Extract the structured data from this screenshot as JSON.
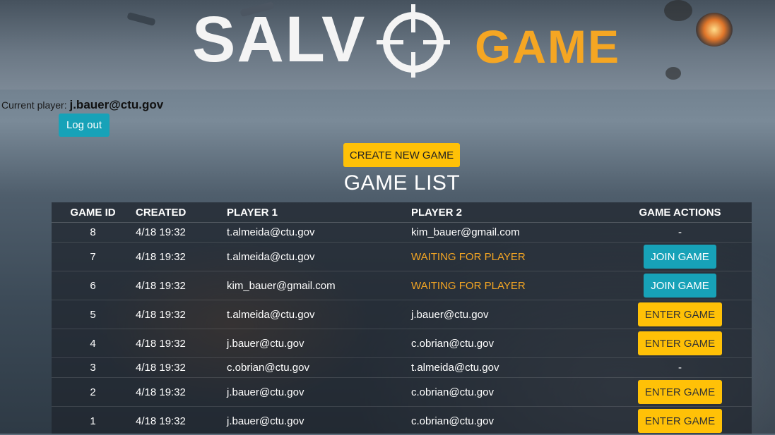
{
  "header": {
    "logo_salvo": "SALV",
    "logo_game": "GAME",
    "accent_color": "#f5a623"
  },
  "session": {
    "current_player_label": "Current player:",
    "current_player_email": "j.bauer@ctu.gov",
    "logout_label": "Log out"
  },
  "actions": {
    "create_game_label": "CREATE NEW GAME"
  },
  "game_list": {
    "title": "GAME LIST",
    "columns": [
      "GAME ID",
      "CREATED",
      "PLAYER 1",
      "PLAYER 2",
      "GAME ACTIONS"
    ],
    "rows": [
      {
        "id": "8",
        "created": "4/18 19:32",
        "player1": "t.almeida@ctu.gov",
        "player2": "kim_bauer@gmail.com",
        "action": "-"
      },
      {
        "id": "7",
        "created": "4/18 19:32",
        "player1": "t.almeida@ctu.gov",
        "player2": "WAITING FOR PLAYER",
        "action": "JOIN GAME"
      },
      {
        "id": "6",
        "created": "4/18 19:32",
        "player1": "kim_bauer@gmail.com",
        "player2": "WAITING FOR PLAYER",
        "action": "JOIN GAME"
      },
      {
        "id": "5",
        "created": "4/18 19:32",
        "player1": "t.almeida@ctu.gov",
        "player2": "j.bauer@ctu.gov",
        "action": "ENTER GAME"
      },
      {
        "id": "4",
        "created": "4/18 19:32",
        "player1": "j.bauer@ctu.gov",
        "player2": "c.obrian@ctu.gov",
        "action": "ENTER GAME"
      },
      {
        "id": "3",
        "created": "4/18 19:32",
        "player1": "c.obrian@ctu.gov",
        "player2": "t.almeida@ctu.gov",
        "action": "-"
      },
      {
        "id": "2",
        "created": "4/18 19:32",
        "player1": "j.bauer@ctu.gov",
        "player2": "c.obrian@ctu.gov",
        "action": "ENTER GAME"
      },
      {
        "id": "1",
        "created": "4/18 19:32",
        "player1": "j.bauer@ctu.gov",
        "player2": "c.obrian@ctu.gov",
        "action": "ENTER GAME"
      }
    ]
  }
}
